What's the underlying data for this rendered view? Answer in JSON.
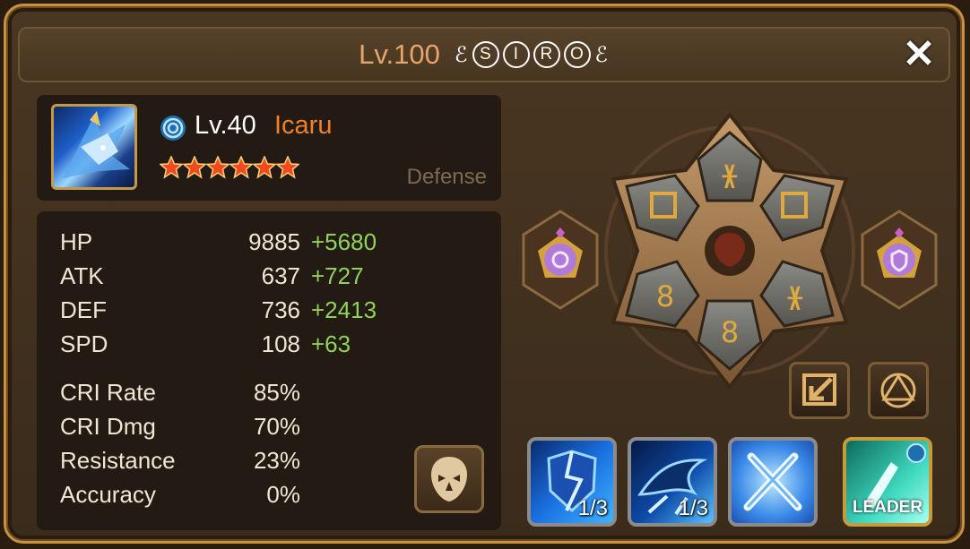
{
  "header": {
    "level": "Lv.100",
    "name_letters": [
      "S",
      "I",
      "R",
      "O"
    ],
    "close_label": "✕"
  },
  "monster": {
    "level": "Lv.40",
    "name": "Icaru",
    "stars": 6,
    "type": "Defense",
    "attribute_icon": "water-attribute-icon",
    "colors": {
      "name": "#f0802a",
      "bonus": "#8fd35a"
    }
  },
  "stats": [
    {
      "label": "HP",
      "value": "9885",
      "bonus": "+5680"
    },
    {
      "label": "ATK",
      "value": "637",
      "bonus": "+727"
    },
    {
      "label": "DEF",
      "value": "736",
      "bonus": "+2413"
    },
    {
      "label": "SPD",
      "value": "108",
      "bonus": "+63"
    },
    {
      "label": "CRI Rate",
      "value": "85%",
      "bonus": ""
    },
    {
      "label": "CRI Dmg",
      "value": "70%",
      "bonus": ""
    },
    {
      "label": "Resistance",
      "value": "23%",
      "bonus": ""
    },
    {
      "label": "Accuracy",
      "value": "0%",
      "bonus": ""
    }
  ],
  "skills": [
    {
      "icon": "ice-shield-skill-icon",
      "count": "1/3"
    },
    {
      "icon": "ice-dragon-skill-icon",
      "count": "1/3"
    },
    {
      "icon": "crossed-swords-skill-icon",
      "count": ""
    },
    {
      "icon": "leader-skill-icon",
      "label": "LEADER"
    }
  ],
  "artifacts": [
    "attribute-artifact-icon",
    "type-artifact-icon"
  ]
}
